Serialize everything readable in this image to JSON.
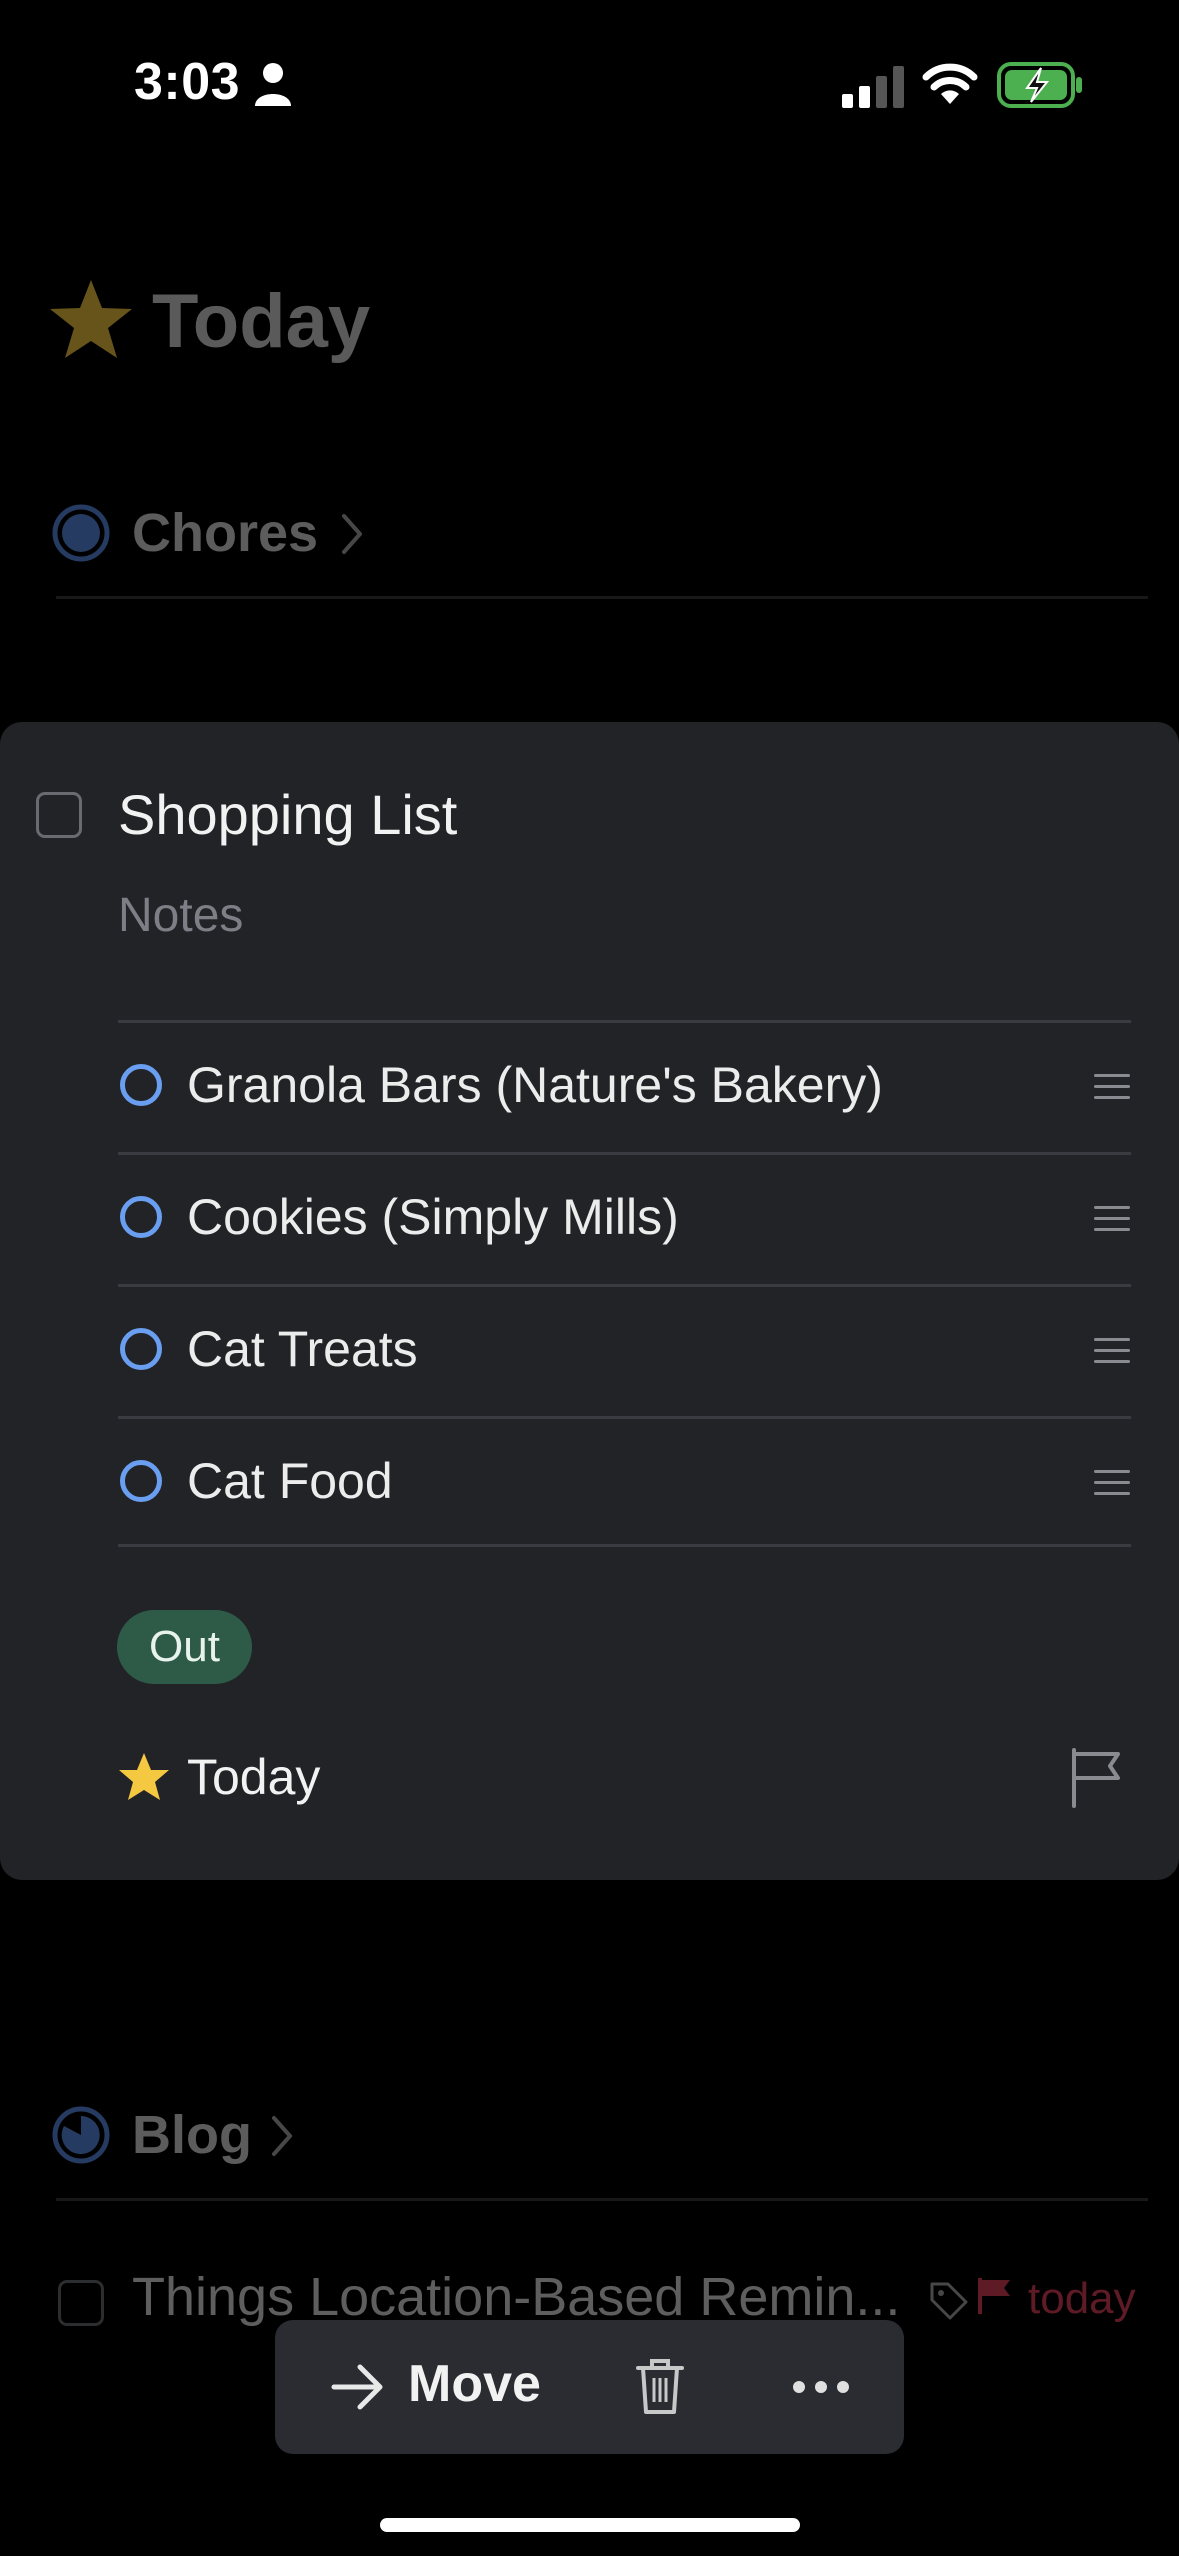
{
  "status_bar": {
    "time": "3:03",
    "icons": [
      "person-icon",
      "signal-icon",
      "wifi-icon",
      "battery-charging-icon"
    ]
  },
  "header": {
    "title": "Today",
    "icon": "star-icon",
    "accent_color": "#f5c842"
  },
  "sections": [
    {
      "title": "Chores",
      "icon": "pie-progress-icon"
    },
    {
      "title": "Blog",
      "icon": "pie-progress-icon"
    }
  ],
  "open_task": {
    "title": "Shopping List",
    "notes_placeholder": "Notes",
    "checklist": [
      {
        "label": "Granola Bars (Nature's Bakery)"
      },
      {
        "label": "Cookies (Simply Mills)"
      },
      {
        "label": "Cat Treats"
      },
      {
        "label": "Cat Food"
      }
    ],
    "tag": "Out",
    "tag_color": "#2e5a48",
    "when": "Today",
    "checklist_color": "#6a9ef0"
  },
  "blog_task": {
    "title": "Things Location-Based Remin...",
    "when": "today",
    "deadline_color": "#e0425a"
  },
  "toolbar": {
    "move_label": "Move"
  }
}
